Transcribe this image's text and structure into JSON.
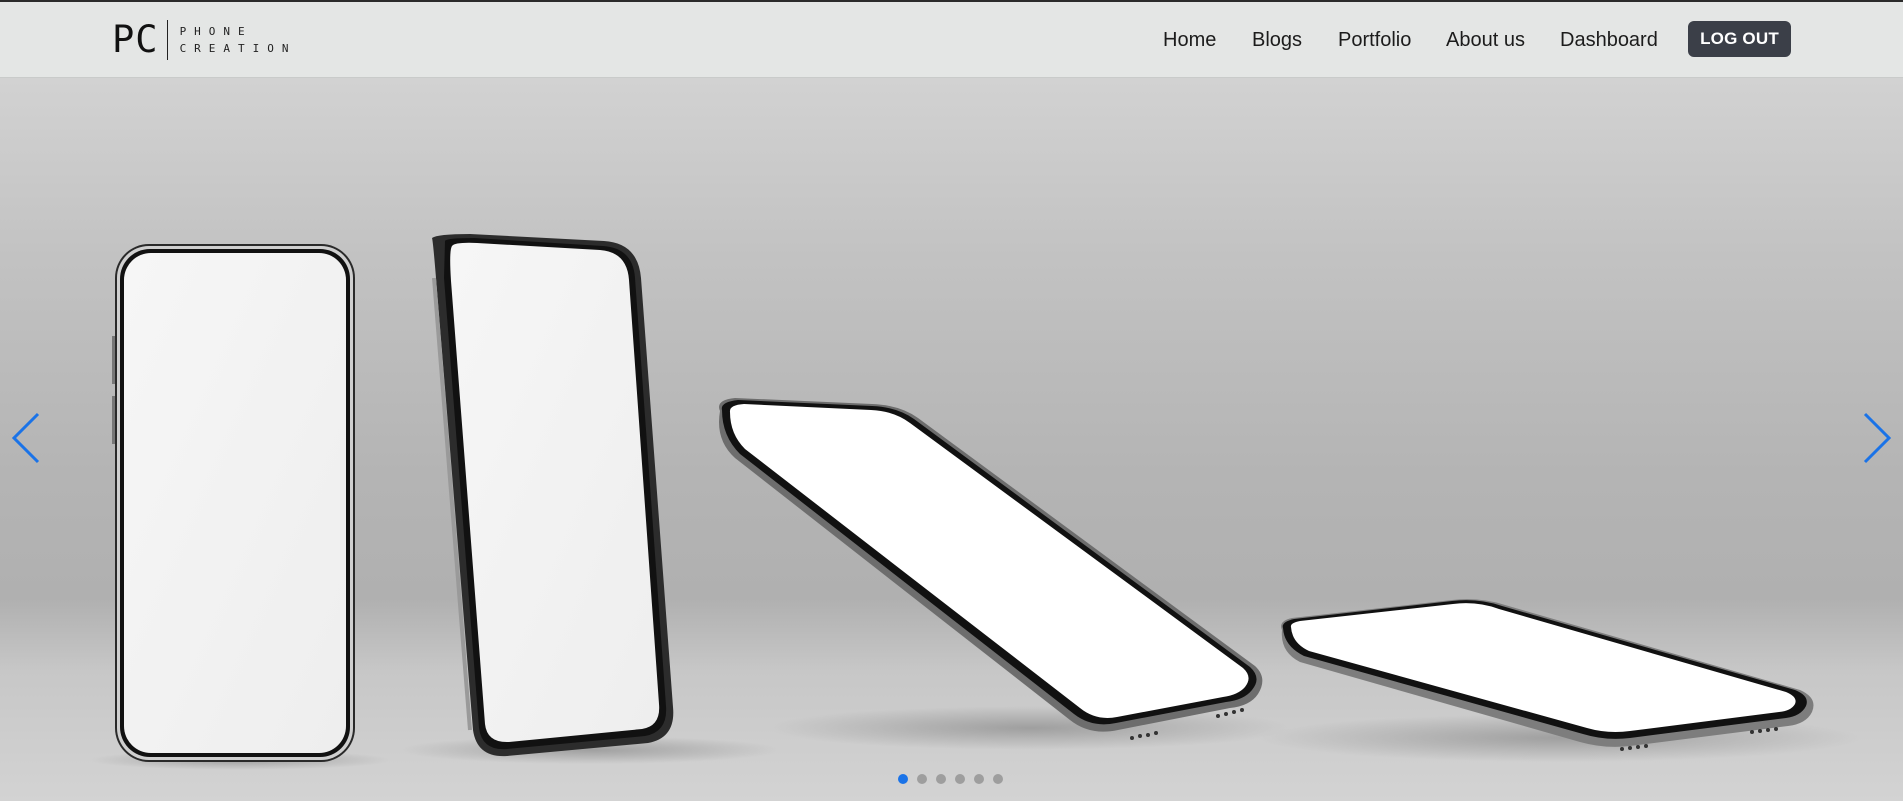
{
  "brand": {
    "initials": "PC",
    "line1": "PHONE",
    "line2": "CREATION"
  },
  "nav": {
    "links": [
      {
        "label": "Home"
      },
      {
        "label": "Blogs"
      },
      {
        "label": "Portfolio"
      },
      {
        "label": "About us"
      },
      {
        "label": "Dashboard"
      }
    ],
    "logout_label": "LOG OUT"
  },
  "carousel": {
    "prev_icon": "chevron-left-icon",
    "next_icon": "chevron-right-icon",
    "slide_count": 6,
    "active_slide": 1,
    "accent_color": "#1a73e8",
    "dot_color": "#9e9e9e"
  }
}
